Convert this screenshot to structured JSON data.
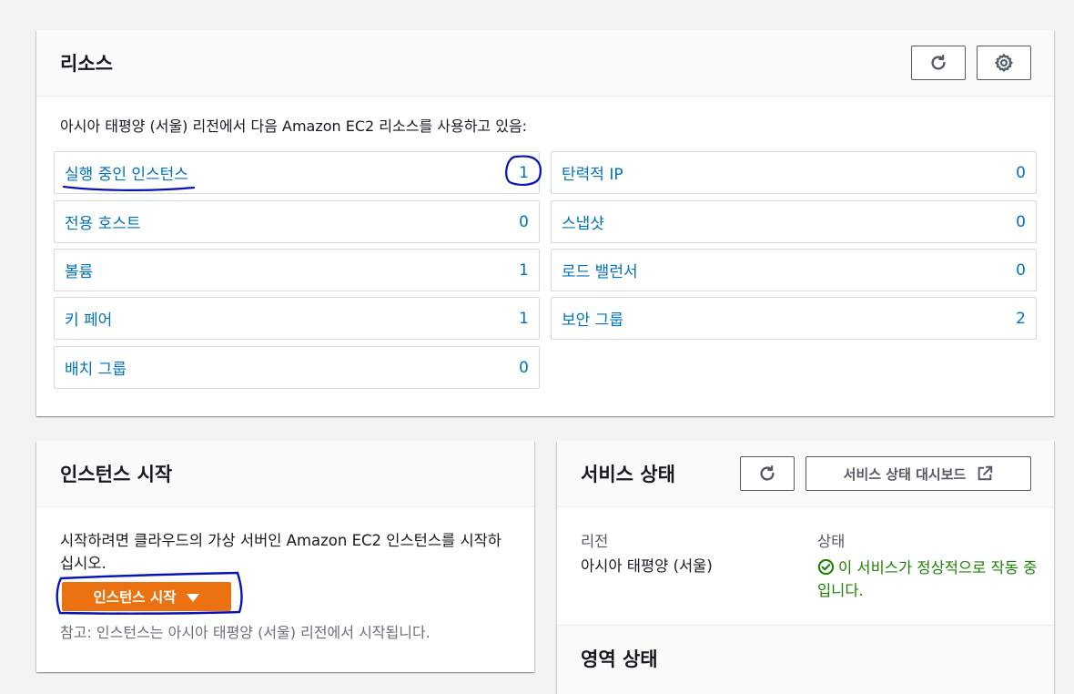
{
  "resources": {
    "title": "리소스",
    "refresh_icon": "refresh-icon",
    "settings_icon": "gear-icon",
    "intro": "아시아 태평양 (서울) 리전에서 다음 Amazon EC2 리소스를 사용하고 있음:",
    "left_items": [
      {
        "label": "실행 중인 인스턴스",
        "count": "1"
      },
      {
        "label": "전용 호스트",
        "count": "0"
      },
      {
        "label": "볼륨",
        "count": "1"
      },
      {
        "label": "키 페어",
        "count": "1"
      },
      {
        "label": "배치 그룹",
        "count": "0"
      }
    ],
    "right_items": [
      {
        "label": "탄력적 IP",
        "count": "0"
      },
      {
        "label": "스냅샷",
        "count": "0"
      },
      {
        "label": "로드 밸런서",
        "count": "0"
      },
      {
        "label": "보안 그룹",
        "count": "2"
      }
    ]
  },
  "launch": {
    "title": "인스턴스 시작",
    "description": "시작하려면 클라우드의 가상 서버인 Amazon EC2 인스턴스를 시작하십시오.",
    "button_label": "인스턴스 시작",
    "note": "참고: 인스턴스는 아시아 태평양 (서울) 리전에서 시작됩니다."
  },
  "service_status": {
    "title": "서비스 상태",
    "dashboard_button": "서비스 상태 대시보드",
    "region_label": "리전",
    "region_value": "아시아 태평양 (서울)",
    "status_label": "상태",
    "status_value": "이 서비스가 정상적으로 작동 중입니다.",
    "zone_title": "영역 상태"
  },
  "colors": {
    "link": "#0073bb",
    "primary_button": "#ec7211",
    "success": "#1d8102",
    "annotation": "#0a14b4"
  }
}
